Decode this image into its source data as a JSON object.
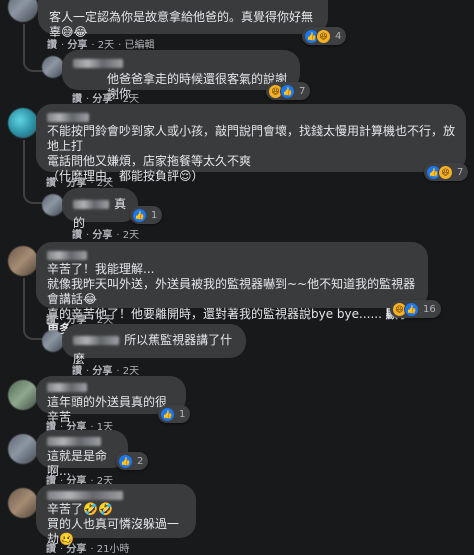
{
  "comments": [
    {
      "text": "客人一定認為你是故意拿給他爸的。真覺得你好無辜😅😂",
      "reactions": {
        "count": "4"
      },
      "meta": {
        "like": "讚",
        "share": "分享",
        "time": "2天",
        "edited": "已編輯"
      }
    },
    {
      "text": "他爸爸拿走的時候還很客氣的說謝謝你",
      "reactions": {
        "count": "7"
      },
      "meta": {
        "like": "讚",
        "share": "分享",
        "time": "2天"
      }
    },
    {
      "text": "不能按門鈴會吵到家人或小孩，敲門說門會壞，找錢太慢用計算機也不行，放地上打\n電話問他又嫌煩，店家拖餐等太久不爽\n（什麼理由，都能按負評😌）",
      "reactions": {
        "count": "7"
      },
      "meta": {
        "like": "讚",
        "share": "分享",
        "time": "2天"
      }
    },
    {
      "text": "真的",
      "reactions": {
        "count": "1"
      },
      "meta": {
        "like": "讚",
        "share": "分享",
        "time": "2天"
      }
    },
    {
      "text": "辛苦了！我能理解...\n就像我昨天叫外送，外送員被我的監視器嚇到~~他不知道我的監視器會講話😂\n真的辛苦他了！他要離開時，還對著我的監視器說bye bye......",
      "more_label": "顯示更多",
      "reactions": {
        "count": "16"
      },
      "meta": {
        "like": "讚",
        "share": "分享",
        "time": "2天"
      }
    },
    {
      "text": "所以蕉監視器講了什麼",
      "meta": {
        "like": "讚",
        "share": "分享",
        "time": "2天"
      }
    },
    {
      "text": "這年頭的外送員真的很辛苦",
      "reactions": {
        "count": "1"
      },
      "meta": {
        "like": "讚",
        "share": "分享",
        "time": "1天"
      }
    },
    {
      "text": "這就是是命啊...",
      "reactions": {
        "count": "2"
      },
      "meta": {
        "like": "讚",
        "share": "分享",
        "time": "2天"
      }
    },
    {
      "text": "辛苦了🤣🤣\n買的人也真可憐沒躲過一劫🥴",
      "meta": {
        "like": "讚",
        "share": "分享",
        "time": "21小時"
      }
    }
  ],
  "icons": {
    "like": "thumbs-up",
    "haha": "laughing-face",
    "care": "heart-face"
  },
  "colors": {
    "background": "#18191a",
    "bubble": "#3a3b3c",
    "like_blue": "#1877f2",
    "meta_text": "#b0b3b8"
  }
}
